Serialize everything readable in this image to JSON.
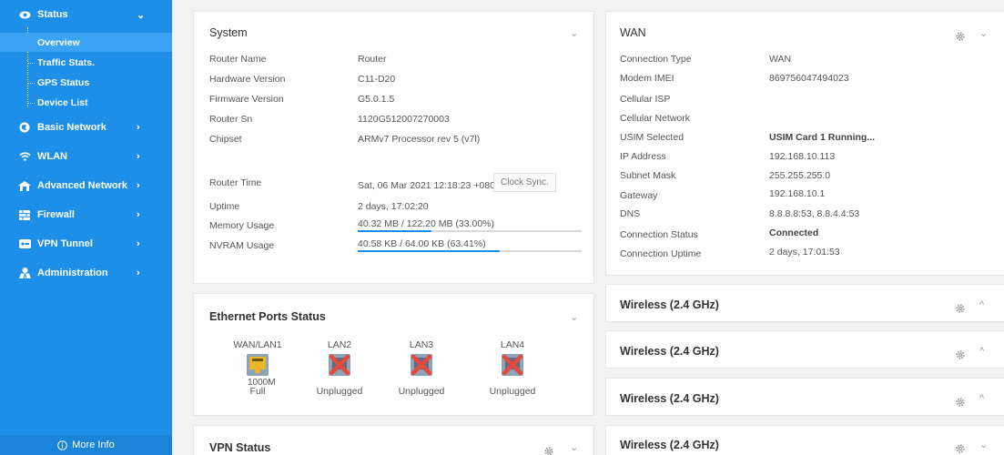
{
  "sidebar": {
    "items": [
      {
        "label": "Status",
        "icon": "eye-icon",
        "chev": "⌄"
      },
      {
        "label": "Basic Network",
        "icon": "globe-icon",
        "chev": "›"
      },
      {
        "label": "WLAN",
        "icon": "wifi-icon",
        "chev": "›"
      },
      {
        "label": "Advanced Network",
        "icon": "network-icon",
        "chev": "›"
      },
      {
        "label": "Firewall",
        "icon": "firewall-icon",
        "chev": "›"
      },
      {
        "label": "VPN Tunnel",
        "icon": "vpn-icon",
        "chev": "›"
      },
      {
        "label": "Administration",
        "icon": "admin-icon",
        "chev": "›"
      }
    ],
    "status_sub": [
      "Overview",
      "Traffic Stats.",
      "GPS Status",
      "Device List"
    ],
    "more_info": "More Info"
  },
  "system": {
    "title": "System",
    "rows": [
      {
        "label": "Router Name",
        "value": "Router"
      },
      {
        "label": "Hardware Version",
        "value": "C11-D20"
      },
      {
        "label": "Firmware Version",
        "value": "G5.0.1.5"
      },
      {
        "label": "Router Sn",
        "value": "1120G512007270003"
      },
      {
        "label": "Chipset",
        "value": "ARMv7 Processor rev 5 (v7l)"
      }
    ],
    "router_time_label": "Router Time",
    "router_time_value": "Sat, 06 Mar 2021 12:18:23 +0800",
    "clock_sync": "Clock Sync.",
    "uptime_label": "Uptime",
    "uptime_value": "2 days, 17:02:20",
    "memory_label": "Memory Usage",
    "memory_value": "40.32 MB / 122.20 MB (33.00%)",
    "memory_percent": 33.0,
    "nvram_label": "NVRAM Usage",
    "nvram_value": "40.58 KB / 64.00 KB (63.41%)",
    "nvram_percent": 63.41
  },
  "ethernet": {
    "title": "Ethernet Ports Status",
    "ports": [
      {
        "name": "WAN/LAN1",
        "speed": "1000M",
        "status": "Full",
        "connected": true
      },
      {
        "name": "LAN2",
        "speed": "",
        "status": "Unplugged",
        "connected": false
      },
      {
        "name": "LAN3",
        "speed": "",
        "status": "Unplugged",
        "connected": false
      },
      {
        "name": "LAN4",
        "speed": "",
        "status": "Unplugged",
        "connected": false
      }
    ]
  },
  "vpn": {
    "title": "VPN Status"
  },
  "wan": {
    "title": "WAN",
    "rows": [
      {
        "label": "Connection Type",
        "value": "WAN",
        "bold": false
      },
      {
        "label": "Modem IMEI",
        "value": "869756047494023",
        "bold": false
      },
      {
        "label": "Cellular ISP",
        "value": "",
        "bold": false
      },
      {
        "label": "Cellular Network",
        "value": "",
        "bold": false
      },
      {
        "label": "USIM Selected",
        "value": "USIM Card 1 Running...",
        "bold": true
      },
      {
        "label": "IP Address",
        "value": "192.168.10.113",
        "bold": false
      },
      {
        "label": "Subnet Mask",
        "value": "255.255.255.0",
        "bold": false
      },
      {
        "label": "Gateway",
        "value": "192.168.10.1",
        "bold": false
      },
      {
        "label": "DNS",
        "value": "8.8.8.8:53, 8.8.4.4:53",
        "bold": false
      },
      {
        "label": "Connection Status",
        "value": "Connected",
        "bold": true
      },
      {
        "label": "Connection Uptime",
        "value": "2 days, 17:01:53",
        "bold": false
      }
    ]
  },
  "wireless": [
    {
      "title": "Wireless (2.4 GHz)",
      "chev": "^"
    },
    {
      "title": "Wireless (2.4 GHz)",
      "chev": "^"
    },
    {
      "title": "Wireless (2.4 GHz)",
      "chev": "^"
    },
    {
      "title": "Wireless (2.4 GHz)",
      "chev": "⌄"
    }
  ],
  "colors": {
    "sidebar": "#1e8fe8",
    "accent": "#1e8fe8",
    "error_x": "#e64a3b"
  }
}
